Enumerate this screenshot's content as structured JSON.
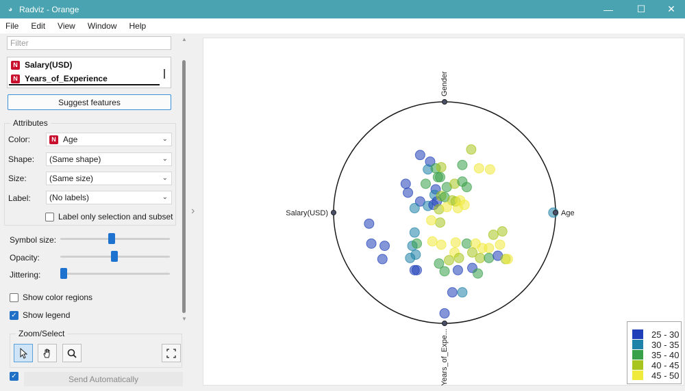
{
  "window": {
    "title": "Radviz - Orange",
    "minimize_glyph": "—",
    "maximize_glyph": "☐",
    "close_glyph": "✕",
    "app_icon": "orange-app-icon"
  },
  "menu": [
    "File",
    "Edit",
    "View",
    "Window",
    "Help"
  ],
  "controls": {
    "filter_placeholder": "Filter",
    "features": [
      {
        "badge": "N",
        "name": "Salary(USD)"
      },
      {
        "badge": "N",
        "name": "Years_of_Experience"
      }
    ],
    "suggest_button": "Suggest features",
    "attributes_title": "Attributes",
    "color_label": "Color:",
    "color_badge": "N",
    "color_value": "Age",
    "shape_label": "Shape:",
    "shape_value": "(Same shape)",
    "size_label": "Size:",
    "size_value": "(Same size)",
    "label_label": "Label:",
    "label_value": "(No labels)",
    "label_only_text": "Label only selection and subset",
    "label_only_checked": false,
    "symbol_size_label": "Symbol size:",
    "symbol_size_level": 0.47,
    "opacity_label": "Opacity:",
    "opacity_level": 0.5,
    "jittering_label": "Jittering:",
    "jittering_level": 0.0,
    "show_color_regions_label": "Show color regions",
    "show_color_regions_checked": false,
    "show_legend_label": "Show legend",
    "show_legend_checked": true,
    "zoom_select_title": "Zoom/Select",
    "zoom_tools": [
      "pointer-icon",
      "hand-pan-icon",
      "magnifier-icon",
      "fit-screen-icon"
    ],
    "send_auto_checked": true,
    "send_button": "Send Automatically"
  },
  "chart_data": {
    "type": "scatter",
    "title": "",
    "anchors": [
      {
        "name": "Gender",
        "angle_deg": 90
      },
      {
        "name": "Age",
        "angle_deg": 0
      },
      {
        "name": "Years_of_Expe...",
        "angle_deg": 270
      },
      {
        "name": "Salary(USD)",
        "angle_deg": 180
      }
    ],
    "legend": {
      "title": "",
      "placement": "bottom-right",
      "bins": [
        {
          "label": "25 - 30",
          "color": "#1f3fb8"
        },
        {
          "label": "30 - 35",
          "color": "#1f82a8"
        },
        {
          "label": "35 - 40",
          "color": "#38a048"
        },
        {
          "label": "40 - 45",
          "color": "#a8c41e"
        },
        {
          "label": "45 - 50",
          "color": "#f0ea3c"
        }
      ]
    },
    "points": [
      {
        "x": -0.22,
        "y": 0.52,
        "age": 28
      },
      {
        "x": -0.13,
        "y": 0.46,
        "age": 27
      },
      {
        "x": 0.24,
        "y": 0.57,
        "age": 43
      },
      {
        "x": 0.16,
        "y": 0.43,
        "age": 37
      },
      {
        "x": 0.31,
        "y": 0.4,
        "age": 45
      },
      {
        "x": 0.41,
        "y": 0.39,
        "age": 46
      },
      {
        "x": -0.15,
        "y": 0.39,
        "age": 31
      },
      {
        "x": -0.08,
        "y": 0.4,
        "age": 36
      },
      {
        "x": -0.03,
        "y": 0.41,
        "age": 41
      },
      {
        "x": -0.06,
        "y": 0.32,
        "age": 38
      },
      {
        "x": -0.17,
        "y": 0.26,
        "age": 39
      },
      {
        "x": 0.02,
        "y": 0.23,
        "age": 39
      },
      {
        "x": -0.04,
        "y": 0.32,
        "age": 35
      },
      {
        "x": -0.08,
        "y": 0.21,
        "age": 28
      },
      {
        "x": -0.35,
        "y": 0.26,
        "age": 28
      },
      {
        "x": -0.09,
        "y": 0.16,
        "age": 31
      },
      {
        "x": 0.09,
        "y": 0.26,
        "age": 40
      },
      {
        "x": 0.16,
        "y": 0.28,
        "age": 38
      },
      {
        "x": 0.2,
        "y": 0.23,
        "age": 36
      },
      {
        "x": -0.33,
        "y": 0.18,
        "age": 27
      },
      {
        "x": -0.22,
        "y": 0.1,
        "age": 29
      },
      {
        "x": -0.27,
        "y": 0.04,
        "age": 33
      },
      {
        "x": -0.15,
        "y": 0.06,
        "age": 33
      },
      {
        "x": -0.1,
        "y": 0.07,
        "age": 28
      },
      {
        "x": -0.07,
        "y": 0.1,
        "age": 25
      },
      {
        "x": -0.03,
        "y": 0.15,
        "age": 40
      },
      {
        "x": 0.0,
        "y": 0.14,
        "age": 36
      },
      {
        "x": 0.07,
        "y": 0.11,
        "age": 42
      },
      {
        "x": 0.1,
        "y": 0.1,
        "age": 44
      },
      {
        "x": 0.14,
        "y": 0.11,
        "age": 45
      },
      {
        "x": 0.18,
        "y": 0.07,
        "age": 47
      },
      {
        "x": 0.12,
        "y": 0.04,
        "age": 45
      },
      {
        "x": -0.05,
        "y": 0.03,
        "age": 43
      },
      {
        "x": 0.02,
        "y": 0.05,
        "age": 45
      },
      {
        "x": -0.04,
        "y": -0.09,
        "age": 40
      },
      {
        "x": -0.12,
        "y": -0.07,
        "age": 46
      },
      {
        "x": 0.98,
        "y": 0.0,
        "age": 32
      },
      {
        "x": -0.68,
        "y": -0.1,
        "age": 27
      },
      {
        "x": -0.66,
        "y": -0.28,
        "age": 27
      },
      {
        "x": -0.54,
        "y": -0.3,
        "age": 27
      },
      {
        "x": -0.56,
        "y": -0.42,
        "age": 27
      },
      {
        "x": -0.27,
        "y": -0.18,
        "age": 32
      },
      {
        "x": -0.29,
        "y": -0.3,
        "age": 31
      },
      {
        "x": -0.25,
        "y": -0.28,
        "age": 35
      },
      {
        "x": -0.31,
        "y": -0.41,
        "age": 34
      },
      {
        "x": -0.26,
        "y": -0.38,
        "age": 30
      },
      {
        "x": -0.25,
        "y": -0.52,
        "age": 27
      },
      {
        "x": -0.11,
        "y": -0.26,
        "age": 46
      },
      {
        "x": -0.03,
        "y": -0.29,
        "age": 45
      },
      {
        "x": 0.1,
        "y": -0.27,
        "age": 46
      },
      {
        "x": 0.2,
        "y": -0.28,
        "age": 36
      },
      {
        "x": 0.09,
        "y": -0.36,
        "age": 45
      },
      {
        "x": 0.04,
        "y": -0.43,
        "age": 40
      },
      {
        "x": -0.05,
        "y": -0.46,
        "age": 38
      },
      {
        "x": 0.13,
        "y": -0.41,
        "age": 42
      },
      {
        "x": 0.28,
        "y": -0.28,
        "age": 48
      },
      {
        "x": 0.34,
        "y": -0.32,
        "age": 49
      },
      {
        "x": 0.4,
        "y": -0.32,
        "age": 45
      },
      {
        "x": 0.25,
        "y": -0.36,
        "age": 44
      },
      {
        "x": 0.32,
        "y": -0.41,
        "age": 42
      },
      {
        "x": 0.44,
        "y": -0.2,
        "age": 43
      },
      {
        "x": 0.52,
        "y": -0.17,
        "age": 42
      },
      {
        "x": 0.5,
        "y": -0.29,
        "age": 46
      },
      {
        "x": 0.4,
        "y": -0.41,
        "age": 36
      },
      {
        "x": 0.48,
        "y": -0.39,
        "age": 29
      },
      {
        "x": 0.55,
        "y": -0.42,
        "age": 44
      },
      {
        "x": 0.57,
        "y": -0.42,
        "age": 47
      },
      {
        "x": 0.0,
        "y": -0.53,
        "age": 36
      },
      {
        "x": 0.12,
        "y": -0.52,
        "age": 27
      },
      {
        "x": 0.25,
        "y": -0.5,
        "age": 28
      },
      {
        "x": 0.3,
        "y": -0.55,
        "age": 35
      },
      {
        "x": -0.27,
        "y": -0.52,
        "age": 27
      },
      {
        "x": 0.07,
        "y": -0.72,
        "age": 27
      },
      {
        "x": 0.16,
        "y": -0.72,
        "age": 32
      },
      {
        "x": 0.0,
        "y": -0.91,
        "age": 27
      }
    ]
  }
}
